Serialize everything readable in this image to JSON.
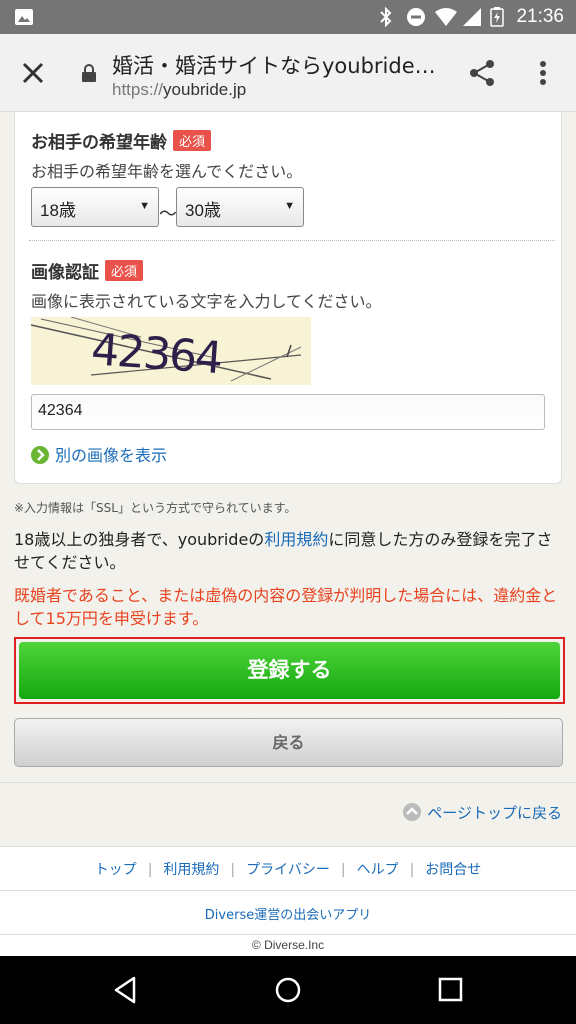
{
  "status_bar": {
    "time": "21:36"
  },
  "browser": {
    "title": "婚活・婚活サイトならyoubride…",
    "url_scheme": "https://",
    "url_host": "youbride.jp"
  },
  "form": {
    "age": {
      "label": "お相手の希望年齢",
      "required_badge": "必須",
      "description": "お相手の希望年齢を選んでください。",
      "min_value": "18歳",
      "separator": "〜",
      "max_value": "30歳"
    },
    "captcha": {
      "label": "画像認証",
      "required_badge": "必須",
      "description": "画像に表示されている文字を入力してください。",
      "image_text": "42364",
      "input_value": "42364",
      "reload_link": "別の画像を表示"
    }
  },
  "notes": {
    "ssl": "※入力情報は「SSL」という方式で守られています。",
    "agree_before": "18歳以上の独身者で、youbrideの",
    "agree_link": "利用規約",
    "agree_after": "に同意した方のみ登録を完了させてください。",
    "warning": "既婚者であること、または虚偽の内容の登録が判明した場合には、違約金として15万円を申受けます。"
  },
  "buttons": {
    "submit": "登録する",
    "back": "戻る"
  },
  "page_top": "ページトップに戻る",
  "footer": {
    "links": [
      "トップ",
      "利用規約",
      "プライバシー",
      "ヘルプ",
      "お問合せ"
    ],
    "app_link": "Diverse運営の出会いアプリ",
    "copyright": "© Diverse.Inc"
  },
  "colors": {
    "required_badge": "#e8524a",
    "submit_green": "#14a80f",
    "warning_text": "#e8431f",
    "link_blue": "#1a6bb8"
  }
}
